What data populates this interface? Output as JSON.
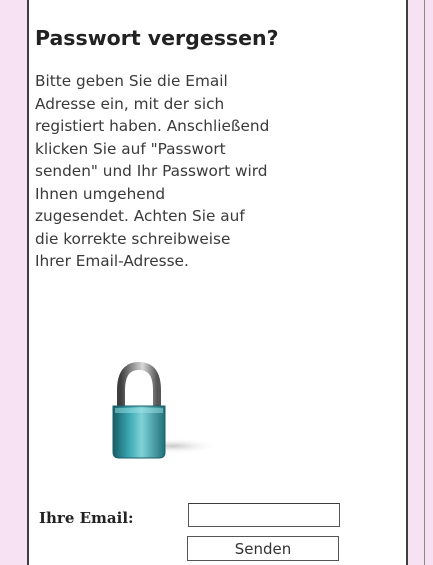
{
  "panel": {
    "title": "Passwort vergessen?",
    "description": "Bitte geben Sie die Email\nAdresse ein, mit der sich\nregistiert haben. Anschließend\nklicken Sie auf \"Passwort\nsenden\" und Ihr Passwort wird\nIhnen umgehend\nzugesendet. Achten Sie auf\ndie korrekte schreibweise\nIhrer Email-Adresse.",
    "icon": "padlock-icon"
  },
  "form": {
    "email_label": "Ihre Email:",
    "email_value": "",
    "send_label": "Senden"
  },
  "colors": {
    "sidebar_background": "#f7e2f4",
    "lock_body": "#2f96a0",
    "lock_shackle": "#6e6e6e"
  }
}
